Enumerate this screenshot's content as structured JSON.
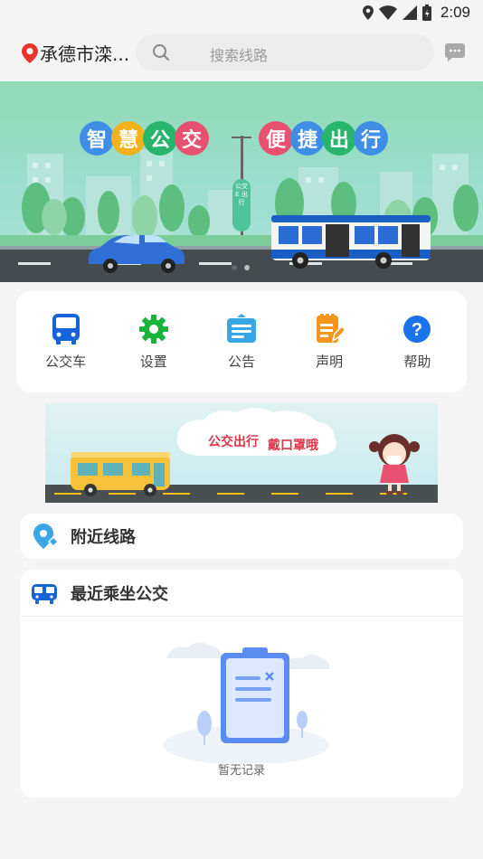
{
  "status": {
    "time": "2:09"
  },
  "header": {
    "city": "承德市滦...",
    "search_placeholder": "搜索线路"
  },
  "banner": {
    "slogan_left": [
      "智",
      "慧",
      "公",
      "交"
    ],
    "slogan_right": [
      "便",
      "捷",
      "出",
      "行"
    ],
    "sign_text": "公交 E 出行"
  },
  "menu": [
    {
      "label": "公交车",
      "icon": "bus-icon"
    },
    {
      "label": "设置",
      "icon": "gear-icon"
    },
    {
      "label": "公告",
      "icon": "notice-icon"
    },
    {
      "label": "声明",
      "icon": "statement-icon"
    },
    {
      "label": "帮助",
      "icon": "help-icon"
    }
  ],
  "promo": {
    "text_a": "公交出行",
    "text_b": "戴口罩哦"
  },
  "nearby": {
    "title": "附近线路"
  },
  "recent": {
    "title": "最近乘坐公交",
    "empty_text": "暂无记录"
  },
  "colors": {
    "menu_blue": "#1565d8",
    "menu_green": "#1ab43c",
    "notice_blue": "#3aa6e8",
    "statement_orange": "#f5951b",
    "help_blue": "#1a73e8"
  }
}
